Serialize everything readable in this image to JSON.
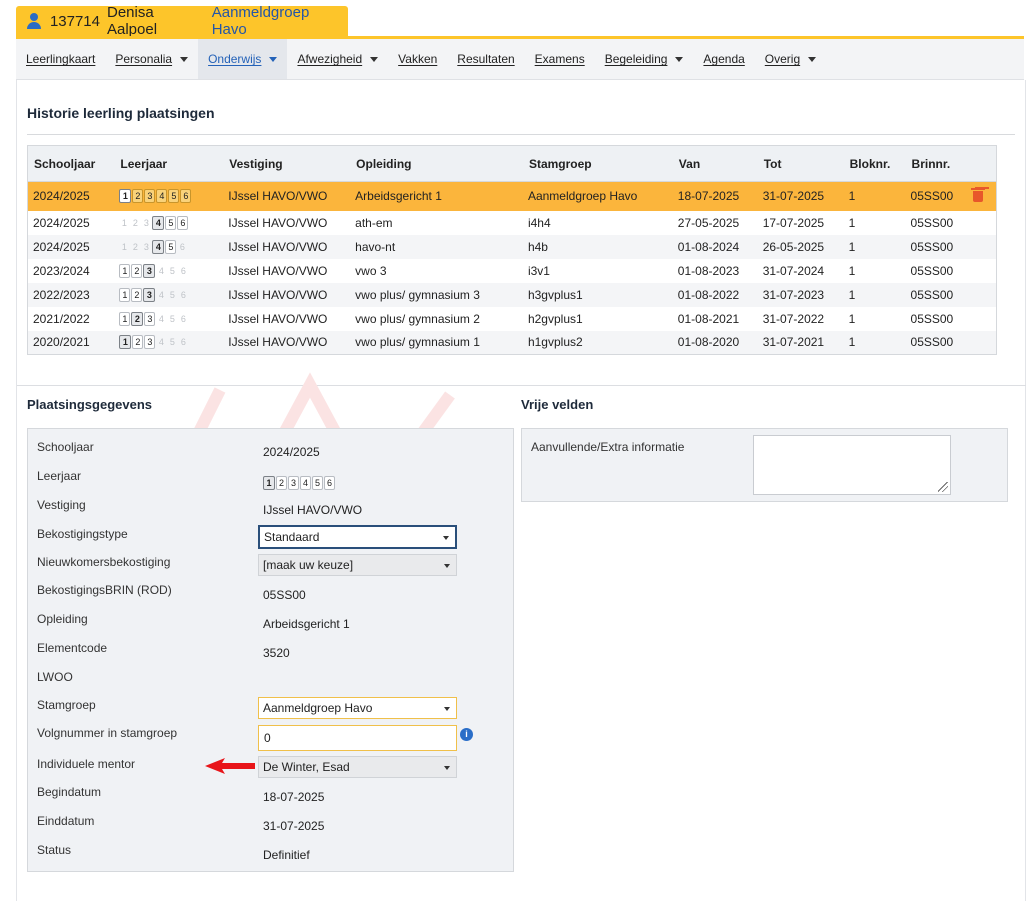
{
  "header": {
    "student_id": "137714",
    "student_name": "Denisa Aalpoel",
    "student_group": "Aanmeldgroep Havo"
  },
  "nav": {
    "items": [
      {
        "label": "Leerlingkaart",
        "dropdown": false
      },
      {
        "label": "Personalia",
        "dropdown": true
      },
      {
        "label": "Onderwijs",
        "dropdown": true,
        "active": true
      },
      {
        "label": "Afwezigheid",
        "dropdown": true
      },
      {
        "label": "Vakken",
        "dropdown": false
      },
      {
        "label": "Resultaten",
        "dropdown": false
      },
      {
        "label": "Examens",
        "dropdown": false
      },
      {
        "label": "Begeleiding",
        "dropdown": true
      },
      {
        "label": "Agenda",
        "dropdown": false
      },
      {
        "label": "Overig",
        "dropdown": true
      }
    ]
  },
  "history": {
    "title": "Historie leerling plaatsingen",
    "columns": [
      "Schooljaar",
      "Leerjaar",
      "Vestiging",
      "Opleiding",
      "Stamgroep",
      "Van",
      "Tot",
      "Bloknr.",
      "Brinnr."
    ],
    "rows": [
      {
        "schooljaar": "2024/2025",
        "years": [
          1,
          2,
          3,
          4,
          5,
          6
        ],
        "enabled": [
          1,
          2,
          3,
          4,
          5,
          6
        ],
        "current": 1,
        "vestiging": "IJssel HAVO/VWO",
        "opleiding": "Arbeidsgericht 1",
        "stamgroep": "Aanmeldgroep Havo",
        "van": "18-07-2025",
        "tot": "31-07-2025",
        "bloknr": "1",
        "brinnr": "05SS00",
        "selected": true
      },
      {
        "schooljaar": "2024/2025",
        "years": [
          1,
          2,
          3,
          4,
          5,
          6
        ],
        "enabled": [
          4,
          5,
          6
        ],
        "current": 4,
        "vestiging": "IJssel HAVO/VWO",
        "opleiding": "ath-em",
        "stamgroep": "i4h4",
        "van": "27-05-2025",
        "tot": "17-07-2025",
        "bloknr": "1",
        "brinnr": "05SS00"
      },
      {
        "schooljaar": "2024/2025",
        "years": [
          1,
          2,
          3,
          4,
          5,
          6
        ],
        "enabled": [
          4,
          5
        ],
        "current": 4,
        "vestiging": "IJssel HAVO/VWO",
        "opleiding": "havo-nt",
        "stamgroep": "h4b",
        "van": "01-08-2024",
        "tot": "26-05-2025",
        "bloknr": "1",
        "brinnr": "05SS00"
      },
      {
        "schooljaar": "2023/2024",
        "years": [
          1,
          2,
          3,
          4,
          5,
          6
        ],
        "enabled": [
          1,
          2,
          3
        ],
        "current": 3,
        "vestiging": "IJssel HAVO/VWO",
        "opleiding": "vwo 3",
        "stamgroep": "i3v1",
        "van": "01-08-2023",
        "tot": "31-07-2024",
        "bloknr": "1",
        "brinnr": "05SS00"
      },
      {
        "schooljaar": "2022/2023",
        "years": [
          1,
          2,
          3,
          4,
          5,
          6
        ],
        "enabled": [
          1,
          2,
          3
        ],
        "current": 3,
        "vestiging": "IJssel HAVO/VWO",
        "opleiding": "vwo plus/ gymnasium 3",
        "stamgroep": "h3gvplus1",
        "van": "01-08-2022",
        "tot": "31-07-2023",
        "bloknr": "1",
        "brinnr": "05SS00"
      },
      {
        "schooljaar": "2021/2022",
        "years": [
          1,
          2,
          3,
          4,
          5,
          6
        ],
        "enabled": [
          1,
          2,
          3
        ],
        "current": 2,
        "vestiging": "IJssel HAVO/VWO",
        "opleiding": "vwo plus/ gymnasium 2",
        "stamgroep": "h2gvplus1",
        "van": "01-08-2021",
        "tot": "31-07-2022",
        "bloknr": "1",
        "brinnr": "05SS00"
      },
      {
        "schooljaar": "2020/2021",
        "years": [
          1,
          2,
          3,
          4,
          5,
          6
        ],
        "enabled": [
          1,
          2,
          3
        ],
        "current": 1,
        "vestiging": "IJssel HAVO/VWO",
        "opleiding": "vwo plus/ gymnasium 1",
        "stamgroep": "h1gvplus2",
        "van": "01-08-2020",
        "tot": "31-07-2021",
        "bloknr": "1",
        "brinnr": "05SS00"
      }
    ]
  },
  "plaatsing": {
    "title": "Plaatsingsgegevens",
    "schooljaar_label": "Schooljaar",
    "schooljaar": "2024/2025",
    "leerjaar_label": "Leerjaar",
    "leerjaar_current": 1,
    "vestiging_label": "Vestiging",
    "vestiging": "IJssel HAVO/VWO",
    "bekostigingstype_label": "Bekostigingstype",
    "bekostigingstype": "Standaard",
    "nieuwkomers_label": "Nieuwkomersbekostiging",
    "nieuwkomers": "[maak uw keuze]",
    "brin_label": "BekostigingsBRIN (ROD)",
    "brin": "05SS00",
    "opleiding_label": "Opleiding",
    "opleiding": "Arbeidsgericht 1",
    "elementcode_label": "Elementcode",
    "elementcode": "3520",
    "lwoo_label": "LWOO",
    "stamgroep_label": "Stamgroep",
    "stamgroep": "Aanmeldgroep Havo",
    "volgnummer_label": "Volgnummer in stamgroep",
    "volgnummer": "0",
    "mentor_label": "Individuele mentor",
    "mentor": "De Winter, Esad",
    "begindatum_label": "Begindatum",
    "begindatum": "18-07-2025",
    "einddatum_label": "Einddatum",
    "einddatum": "31-07-2025",
    "status_label": "Status",
    "status": "Definitief"
  },
  "vrije_velden": {
    "title": "Vrije velden",
    "extra_label": "Aanvullende/Extra informatie",
    "extra_value": ""
  },
  "colors": {
    "accent_yellow": "#fdc52a",
    "selected_row": "#fbb53c",
    "link_blue": "#2462b8",
    "delete_red": "#e8572a",
    "arrow_red": "#e8151a"
  }
}
